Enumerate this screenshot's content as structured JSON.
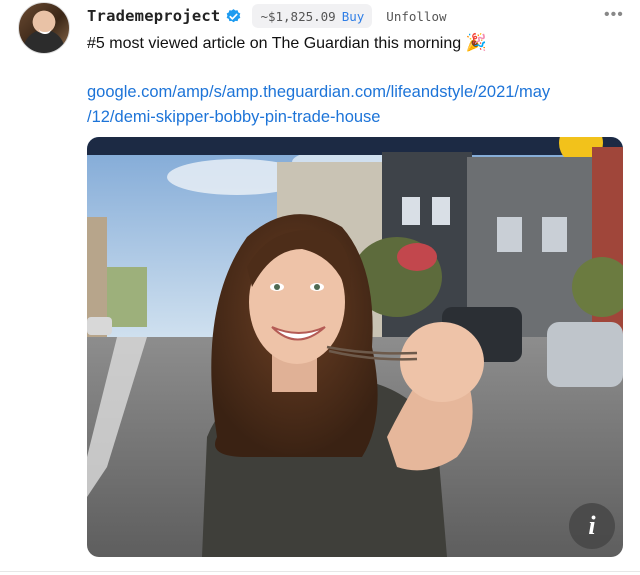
{
  "post": {
    "username": "Trademeproject",
    "price": "~$1,825.09",
    "buy_label": "Buy",
    "unfollow_label": "Unfollow",
    "more_label": "•••",
    "text": "#5 most viewed article on The Guardian this morning",
    "emoji": "🎉",
    "link_line1": "google.com/amp/s/amp.theguardian.com/lifeandstyle/2021/may",
    "link_line2": "/12/demi-skipper-bobby-pin-trade-house"
  },
  "media": {
    "info_label": "i"
  },
  "colors": {
    "link": "#1d74d8",
    "buy": "#2f7ee6",
    "verified": "#1d9bf0"
  },
  "icons": {
    "verified": "verified-badge-icon",
    "more": "more-dots-icon",
    "info": "info-icon"
  }
}
